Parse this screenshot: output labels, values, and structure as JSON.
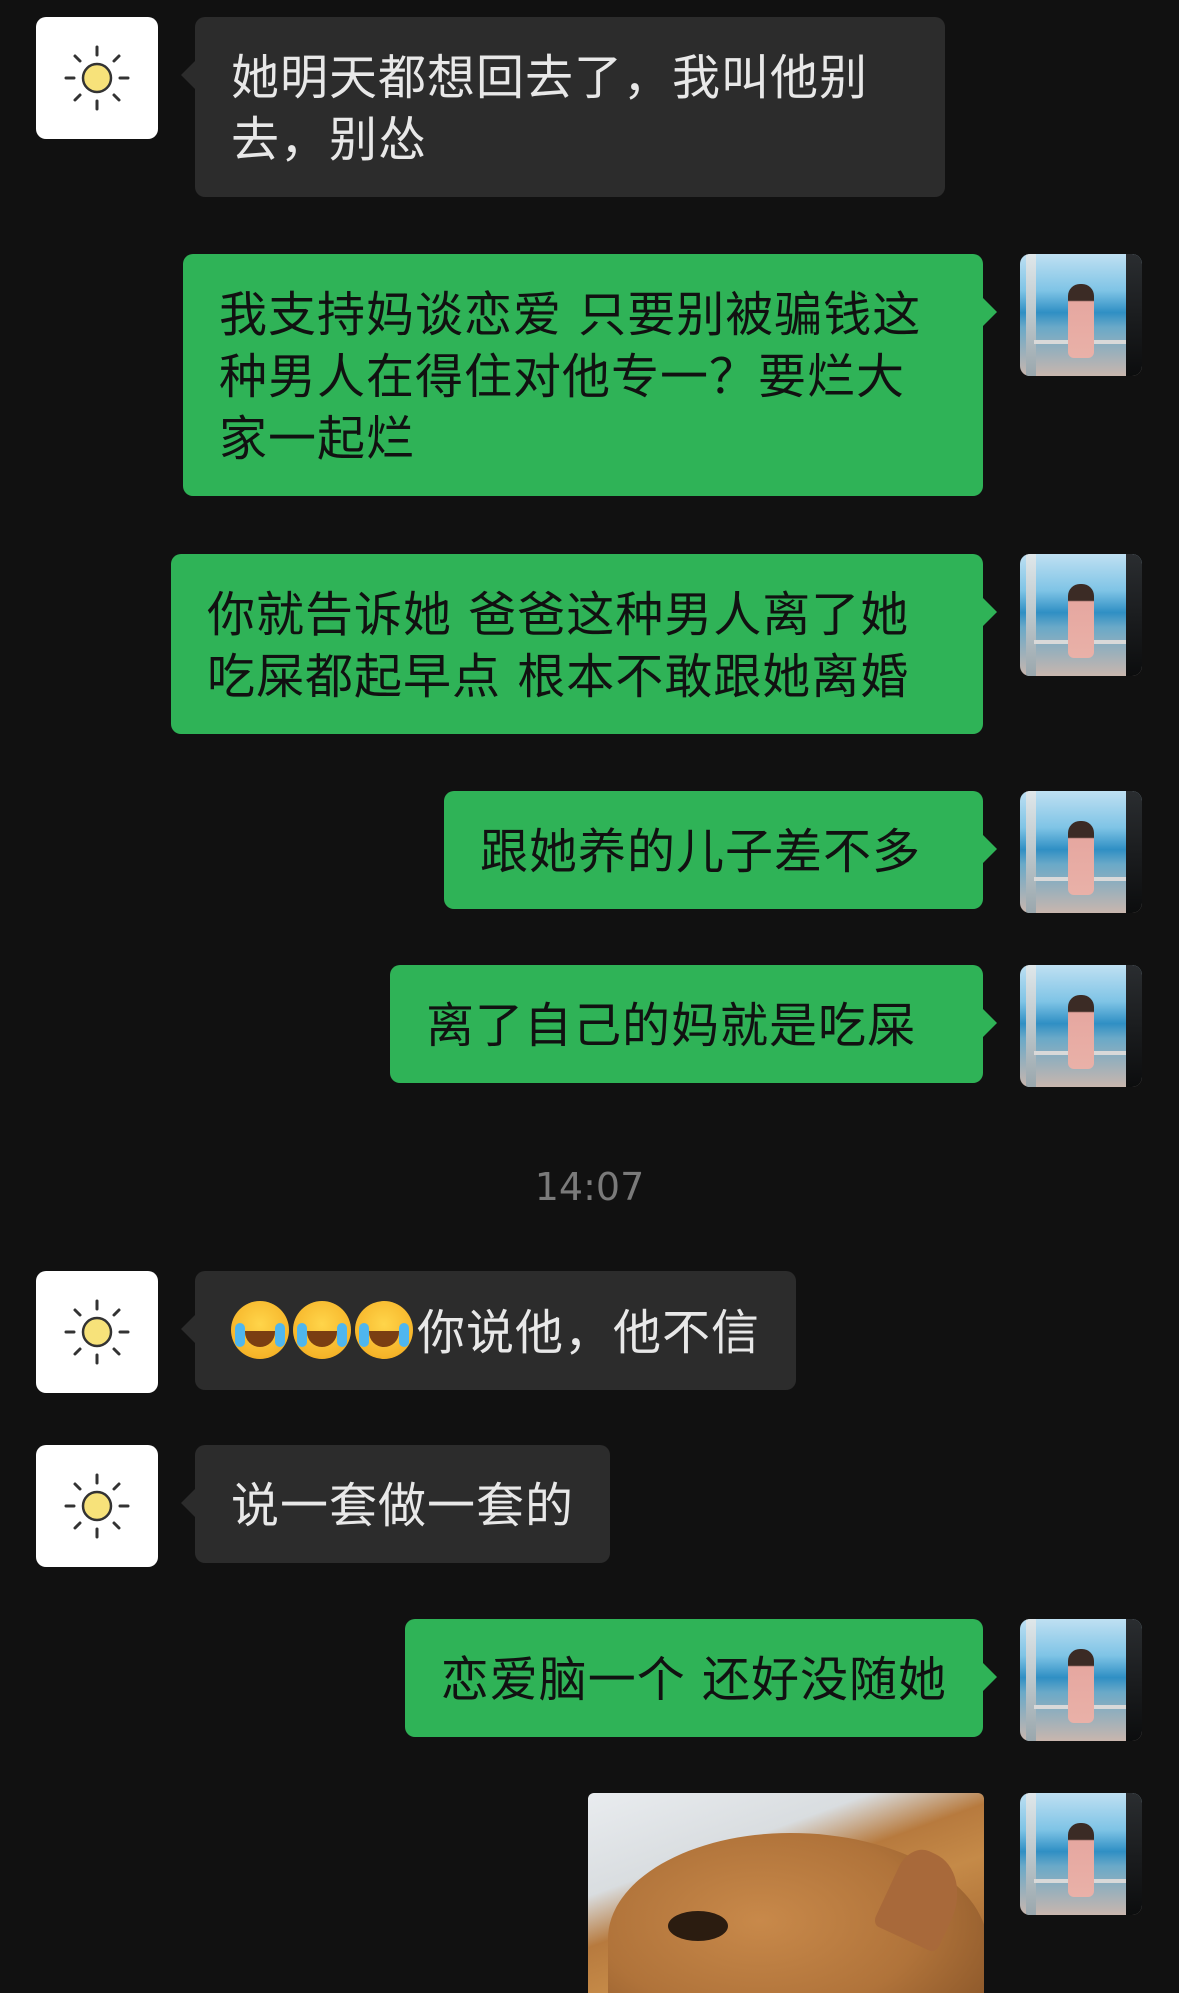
{
  "messages": [
    {
      "side": "in",
      "text": "她明天都想回去了，我叫他别去，别怂"
    },
    {
      "side": "out",
      "text": "我支持妈谈恋爱 只要别被骗钱这种男人在得住对他专一？要烂大家一起烂"
    },
    {
      "side": "out",
      "text": "你就告诉她 爸爸这种男人离了她吃屎都起早点 根本不敢跟她离婚"
    },
    {
      "side": "out",
      "text": "跟她养的儿子差不多"
    },
    {
      "side": "out",
      "text": "离了自己的妈就是吃屎"
    },
    {
      "timestamp": "14:07"
    },
    {
      "side": "in",
      "text": "你说他，他不信",
      "emoji_prefix": [
        "loudly-crying-face",
        "loudly-crying-face",
        "loudly-crying-face"
      ]
    },
    {
      "side": "in",
      "text": "说一套做一套的"
    },
    {
      "side": "out",
      "text": "恋爱脑一个 还好没随她"
    },
    {
      "side": "out",
      "type": "image",
      "alt_icon": "cat-photo"
    }
  ],
  "colors": {
    "background": "#111111",
    "incoming_bubble": "#2c2c2c",
    "outgoing_bubble": "#2fb357",
    "timestamp": "#7a7a7a"
  }
}
